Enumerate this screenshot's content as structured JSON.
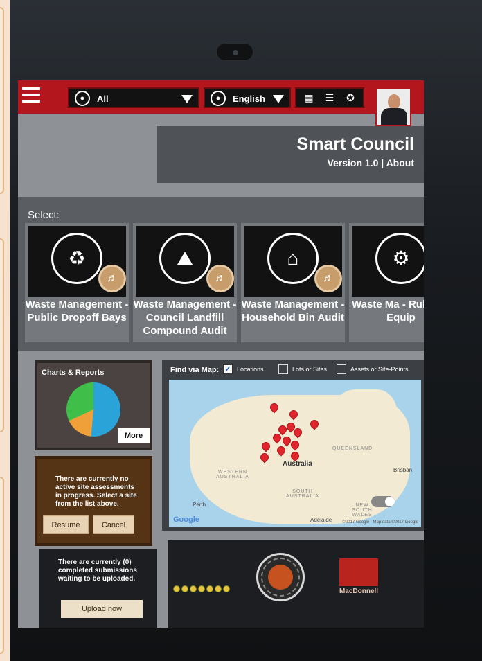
{
  "topbar": {
    "location_value": "All",
    "language_value": "English"
  },
  "header": {
    "title": "Smart Council",
    "version": "Version 1.0",
    "separator": " | ",
    "about_link": "About"
  },
  "select": {
    "label": "Select:",
    "cards": [
      {
        "label": "Waste Management - Public Dropoff Bays"
      },
      {
        "label": "Waste Management - Council Landfill Compound Audit"
      },
      {
        "label": "Waste Management - Household Bin Audit"
      },
      {
        "label": "Waste Ma - Rubbish Equip"
      }
    ]
  },
  "charts": {
    "title": "Charts & Reports",
    "more_label": "More"
  },
  "assessment": {
    "message": "There are currently no active site assessments in progress. Select a site from the list above.",
    "resume_label": "Resume",
    "cancel_label": "Cancel"
  },
  "submissions": {
    "message": "There are currently (0) completed submissions waiting to be uploaded.",
    "upload_label": "Upload now"
  },
  "map": {
    "find_label": "Find via Map:",
    "filters": [
      {
        "label": "Locations",
        "checked": true
      },
      {
        "label": "Lots or Sites",
        "checked": false
      },
      {
        "label": "Assets or Site-Points",
        "checked": false
      }
    ],
    "labels": {
      "queensland": "QUEENSLAND",
      "western_australia": "WESTERN AUSTRALIA",
      "south_australia": "SOUTH AUSTRALIA",
      "new_south_wales": "NEW SOUTH WALES",
      "australia": "Australia",
      "perth": "Perth",
      "adelaide": "Adelaide",
      "brisbane": "Brisban"
    },
    "google": "Google",
    "attribution": "©2017 Google · Map data ©2017 Google"
  },
  "logos": {
    "macdonnell": "MacDonnell"
  },
  "colors": {
    "topbar_red": "#b3161d",
    "panel_dark": "#4f5358",
    "pin_red": "#e0252c"
  }
}
